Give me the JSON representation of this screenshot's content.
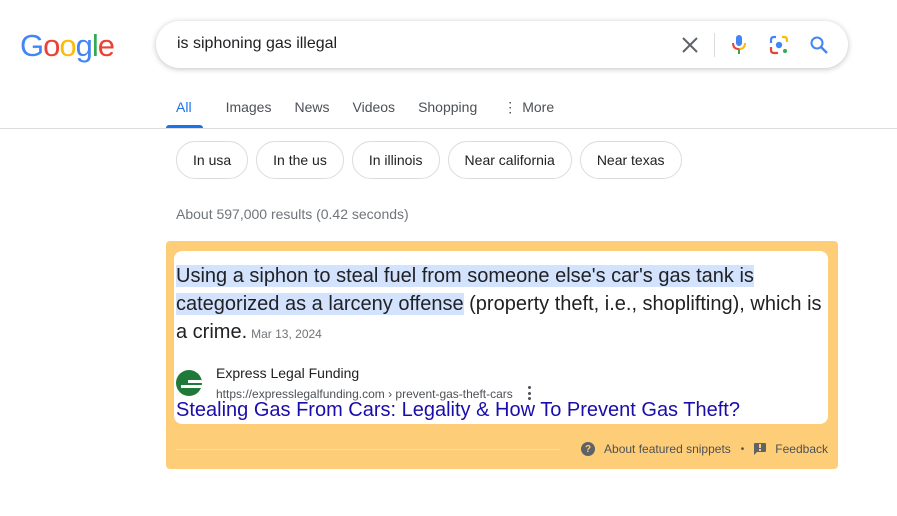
{
  "logo": {
    "letters": [
      {
        "char": "G",
        "color": "#4285f4"
      },
      {
        "char": "o",
        "color": "#ea4335"
      },
      {
        "char": "o",
        "color": "#fbbc05"
      },
      {
        "char": "g",
        "color": "#4285f4"
      },
      {
        "char": "l",
        "color": "#34a853"
      },
      {
        "char": "e",
        "color": "#ea4335"
      }
    ]
  },
  "search": {
    "query": "is siphoning gas illegal",
    "icons": [
      "clear-icon",
      "microphone-icon",
      "google-lens-icon",
      "search-icon"
    ]
  },
  "tabs": [
    {
      "label": "All",
      "active": true
    },
    {
      "label": "Images",
      "active": false
    },
    {
      "label": "News",
      "active": false
    },
    {
      "label": "Videos",
      "active": false
    },
    {
      "label": "Shopping",
      "active": false
    },
    {
      "label": "More",
      "active": false,
      "icon": "vertical-dots-icon"
    }
  ],
  "chips": [
    "In usa",
    "In the us",
    "In illinois",
    "Near california",
    "Near texas"
  ],
  "result_stats": "About 597,000 results (0.42 seconds)",
  "featured_snippet": {
    "highlighted_text": "Using a siphon to steal fuel from someone else's car's gas tank is categorized as a larceny offense",
    "rest_text": " (property theft, i.e., shoplifting), which is a crime.",
    "date": "Mar 13, 2024",
    "source": {
      "site_name": "Express Legal Funding",
      "url": "https://expresslegalfunding.com › prevent-gas-theft-cars",
      "favicon_color": "#1f7a3a"
    },
    "title": "Stealing Gas From Cars: Legality & How To Prevent Gas Theft?",
    "footer": {
      "about_label": "About featured snippets",
      "separator": "•",
      "feedback_label": "Feedback"
    }
  },
  "colors": {
    "accent": "#1a73e8",
    "link": "#1a0dab",
    "snippet_background": "#fecd78",
    "highlight": "#d3e3fd"
  }
}
